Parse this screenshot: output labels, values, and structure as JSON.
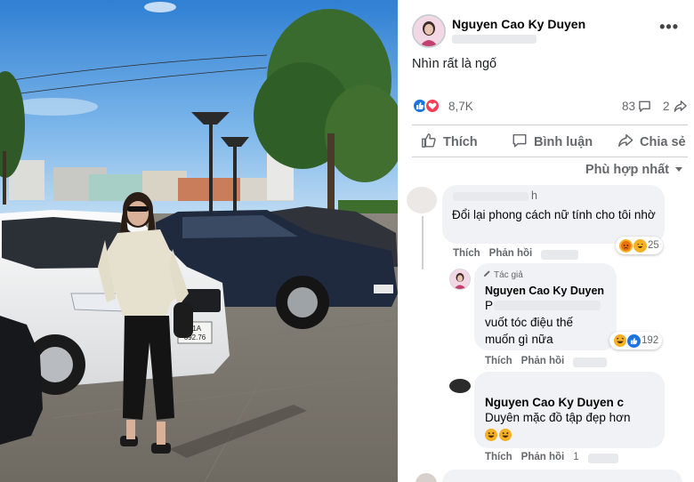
{
  "post": {
    "author": "Nguyen Cao Ky Duyen",
    "caption": "Nhìn rất là ngố",
    "reactions_count": "8,7K",
    "comments_count": "83",
    "shares_count": "2",
    "actions": {
      "like": "Thích",
      "comment": "Bình luận",
      "share": "Chia sẻ"
    },
    "more_icon": "more-horizontal-icon"
  },
  "sort_label": "Phù hợp nhất",
  "comments": [
    {
      "name_suffix": "h",
      "text": "Đổi lại phong cách nữ tính cho tôi nhờ",
      "like_label": "Thích",
      "reply_label": "Phản hồi",
      "reaction_count": "25"
    },
    {
      "author_tag": "Tác giả",
      "name": "Nguyen Cao Ky Duyen",
      "sub_prefix": "P",
      "text": "vuốt tóc điệu thế muốn gì nữa",
      "like_label": "Thích",
      "reply_label": "Phản hồi",
      "reaction_count": "192"
    },
    {
      "name": "Nguyen Cao Ky Duyen c",
      "text": "Duyên mặc đồ tập đẹp hơn",
      "like_label": "Thích",
      "reply_label": "Phản hồi",
      "meta_suffix": "1"
    }
  ],
  "photo": {
    "plate_line1": "51A",
    "plate_line2": "692.76"
  },
  "colors": {
    "facebook_blue": "#1b74e4",
    "love_red": "#f33e58",
    "secondary_text": "#65676b",
    "bubble_bg": "#f0f2f5"
  }
}
